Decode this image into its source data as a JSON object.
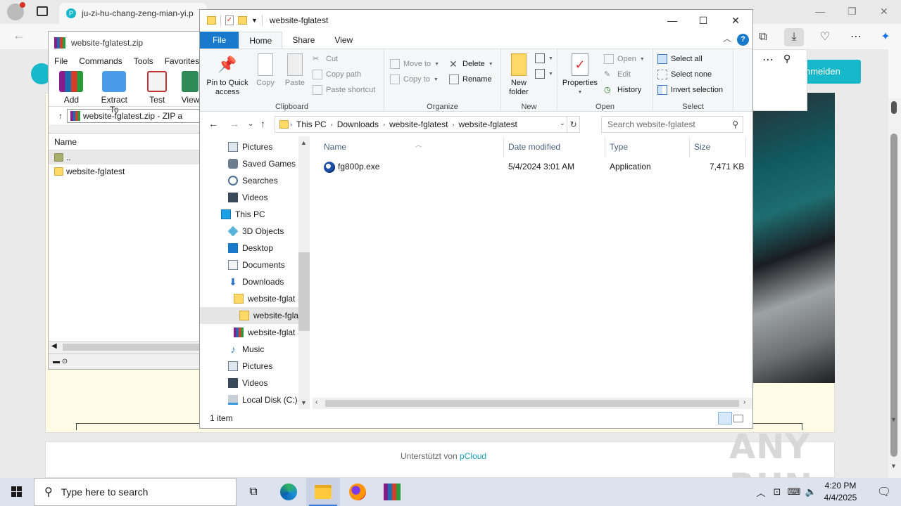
{
  "browser": {
    "tab_title": "ju-zi-hu-chang-zeng-mian-yi.p",
    "tab_favicon": "P",
    "signin_button": "nmeiden",
    "footer_prefix": "Unterstützt von",
    "footer_link": "pCloud",
    "watermark": "ANY RUN",
    "min_glyph": "—",
    "restore_glyph": "❐",
    "close_glyph": "✕"
  },
  "winrar": {
    "title": "website-fglatest.zip",
    "menu": [
      "File",
      "Commands",
      "Tools",
      "Favorites"
    ],
    "tools": [
      "Add",
      "Extract To",
      "Test",
      "View"
    ],
    "path": "website-fglatest.zip - ZIP a",
    "column_name": "Name",
    "rows": [
      "..",
      "website-fglatest"
    ]
  },
  "explorer": {
    "title": "website-fglatest",
    "tabs": {
      "file": "File",
      "home": "Home",
      "share": "Share",
      "view": "View"
    },
    "help": "?",
    "ribbon": {
      "clipboard": {
        "label": "Clipboard",
        "pin": "Pin to Quick access",
        "copy": "Copy",
        "paste": "Paste",
        "cut": "Cut",
        "copy_path": "Copy path",
        "paste_shortcut": "Paste shortcut"
      },
      "organize": {
        "label": "Organize",
        "move_to": "Move to",
        "copy_to": "Copy to",
        "delete": "Delete",
        "rename": "Rename"
      },
      "new": {
        "label": "New",
        "new_folder": "New folder"
      },
      "open": {
        "label": "Open",
        "properties": "Properties",
        "open": "Open",
        "edit": "Edit",
        "history": "History"
      },
      "select": {
        "label": "Select",
        "select_all": "Select all",
        "select_none": "Select none",
        "invert": "Invert selection"
      }
    },
    "address": [
      "This PC",
      "Downloads",
      "website-fglatest",
      "website-fglatest"
    ],
    "search_placeholder": "Search website-fglatest",
    "tree": [
      {
        "label": "Pictures",
        "icon": "pictures-icon"
      },
      {
        "label": "Saved Games",
        "icon": "saved-games-icon"
      },
      {
        "label": "Searches",
        "icon": "searches-icon"
      },
      {
        "label": "Videos",
        "icon": "videos-icon"
      },
      {
        "label": "This PC",
        "icon": "this-pc-icon"
      },
      {
        "label": "3D Objects",
        "icon": "3d-objects-icon"
      },
      {
        "label": "Desktop",
        "icon": "desktop-icon"
      },
      {
        "label": "Documents",
        "icon": "documents-icon"
      },
      {
        "label": "Downloads",
        "icon": "downloads-icon"
      },
      {
        "label": "website-fglat",
        "icon": "folder-icon"
      },
      {
        "label": "website-fgla",
        "icon": "folder-icon"
      },
      {
        "label": "website-fglat",
        "icon": "winrar-archive-icon"
      },
      {
        "label": "Music",
        "icon": "music-icon"
      },
      {
        "label": "Pictures",
        "icon": "pictures-icon"
      },
      {
        "label": "Videos",
        "icon": "videos-icon"
      },
      {
        "label": "Local Disk (C:)",
        "icon": "local-disk-icon"
      }
    ],
    "columns": {
      "name": "Name",
      "date": "Date modified",
      "type": "Type",
      "size": "Size"
    },
    "files": [
      {
        "name": "fg800p.exe",
        "date": "5/4/2024 3:01 AM",
        "type": "Application",
        "size": "7,471 KB"
      }
    ],
    "status": "1 item"
  },
  "taskbar": {
    "search_placeholder": "Type here to search",
    "time": "4:20 PM",
    "date": "4/4/2025"
  },
  "colors": {
    "accent": "#1979ca",
    "page_accent": "#17b8c9"
  }
}
